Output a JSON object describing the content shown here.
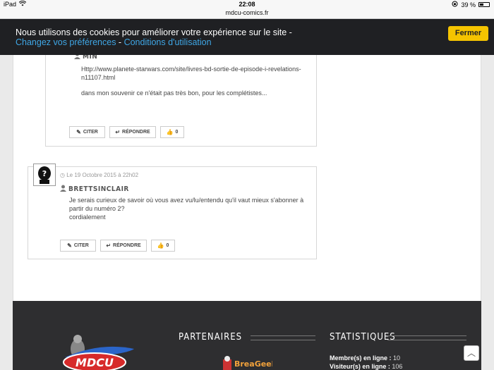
{
  "statusbar": {
    "device": "iPad",
    "time": "22:08",
    "battery": "39 %",
    "battery_level": 0.39
  },
  "urlbar": {
    "url": "mdcu-comics.fr"
  },
  "cookie": {
    "text": "Nous utilisons des cookies pour améliorer votre expérience sur le site - ",
    "link_prefs": "Changez vos préférences",
    "separator": " - ",
    "link_terms": "Conditions d'utilisation",
    "close_label": "Fermer"
  },
  "comments": [
    {
      "author": "MIN",
      "body_line1": "Http://www.planete-starwars.com/site/livres-bd-sortie-de-episode-i-revelations-n11107.html",
      "body_line2": "dans mon souvenir ce n'était pas très bon, pour les complétistes...",
      "cite_label": "CITER",
      "reply_label": "RÉPONDRE",
      "like_count": "0"
    },
    {
      "date": "Le 19 Octobre 2015 à 22h02",
      "author": "BRETTSINCLAIR",
      "body": "Je serais curieux de savoir où vous avez vu/lu/entendu qu'il vaut mieux s'abonner à partir du numéro 2?\ncordialement",
      "cite_label": "CITER",
      "reply_label": "RÉPONDRE",
      "like_count": "0"
    }
  ],
  "footer": {
    "logo_text": "MDCU",
    "partners_title": "PARTENAIRES",
    "stats_title": "STATISTIQUES",
    "partner_logo_text": "BreaGeek",
    "stats": [
      {
        "label": "Membre(s) en ligne :",
        "value": "10"
      },
      {
        "label": "Visiteur(s) en ligne :",
        "value": "106"
      }
    ]
  },
  "icons": {
    "scroll_top": "chevron-up-icon"
  }
}
